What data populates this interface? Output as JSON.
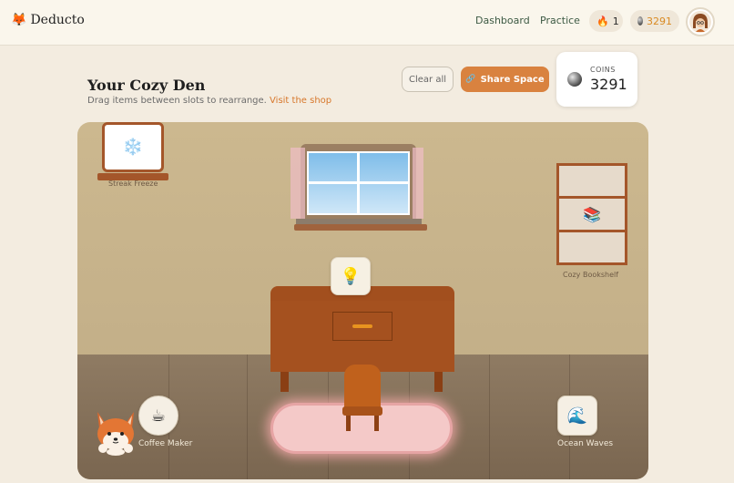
{
  "app": {
    "name": "Deducto"
  },
  "nav": {
    "dashboard": "Dashboard",
    "practice": "Practice"
  },
  "status": {
    "streak": "1",
    "coins": "3291"
  },
  "page": {
    "title": "Your Cozy Den",
    "subtitle": "Drag items between slots to rearrange. ",
    "shop_link": "Visit the shop"
  },
  "actions": {
    "clear_all": "Clear all",
    "share_space": "Share Space"
  },
  "coins_card": {
    "label": "COINS",
    "value": "3291"
  },
  "room": {
    "slots": {
      "wall_left": {
        "label": "Streak Freeze",
        "icon": "❄️"
      },
      "wall_right": {
        "label": "Cozy Bookshelf",
        "icon": "📚"
      },
      "desk": {
        "label": "Lamp",
        "icon": "💡"
      },
      "floor_left": {
        "label": "Coffee Maker",
        "icon": "☕"
      },
      "floor_right": {
        "label": "Ocean Waves",
        "icon": "🌊"
      }
    }
  },
  "colors": {
    "accent": "#d9823f",
    "link": "#d7772b",
    "nav": "#3d5a44"
  }
}
